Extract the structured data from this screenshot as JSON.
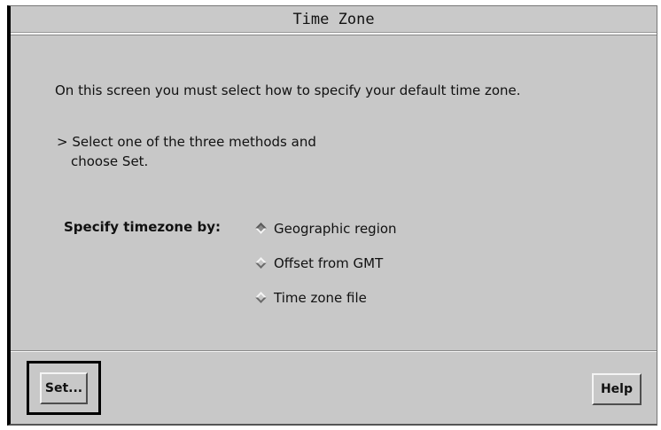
{
  "window": {
    "title": "Time Zone"
  },
  "content": {
    "intro": "On this screen you must select how to specify your default time zone.",
    "instruction_line1": "> Select one of the three methods and",
    "instruction_line2": "choose Set.",
    "specify_label": "Specify timezone by:",
    "options": [
      {
        "label": "Geographic region",
        "selected": true
      },
      {
        "label": "Offset from GMT",
        "selected": false
      },
      {
        "label": "Time zone file",
        "selected": false
      }
    ]
  },
  "buttons": {
    "set": "Set...",
    "help": "Help"
  }
}
